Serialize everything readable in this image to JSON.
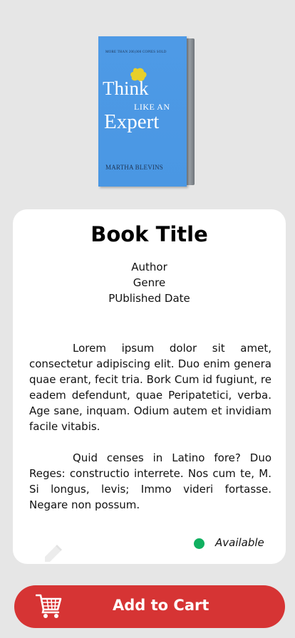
{
  "cover": {
    "tagline": "MORE THAN 200,000 COPIES SOLD",
    "title_line1": "Think",
    "title_line2": "LIKE AN",
    "title_line3": "Expert",
    "author": "MARTHA BLEVINS"
  },
  "book": {
    "title": "Book Title",
    "author": "Author",
    "genre": "Genre",
    "published": "PUblished Date",
    "description_p1": "Lorem ipsum dolor sit amet, consectetur adipiscing elit. Duo enim genera quae erant, fecit tria. Bork Cum id fugiunt, re eadem defendunt, quae Peripatetici, verba. Age sane, inquam. Odium autem et invidiam facile vitabis.",
    "description_p2": "Quid censes in Latino fore? Duo Reges: constructio interrete. Nos cum te, M. Si longus, levis; Immo videri fortasse. Negare non possum.",
    "status": "Available",
    "status_color": "#10b060"
  },
  "icons": {
    "edit": "pencil-icon",
    "cart": "shopping-cart-icon"
  },
  "actions": {
    "add_to_cart": "Add to Cart",
    "button_color": "#d63434"
  }
}
